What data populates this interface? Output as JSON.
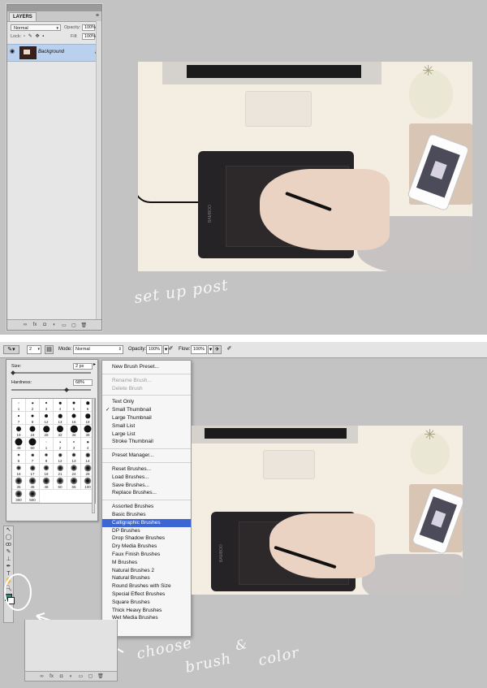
{
  "top": {
    "layers_panel": {
      "tab": "LAYERS",
      "blend_mode": "Normal",
      "opacity_label": "Opacity:",
      "opacity_value": "100%",
      "lock_label": "Lock:",
      "fill_label": "Fill:",
      "fill_value": "100%",
      "layer_name": "Background"
    },
    "caption": "set up post"
  },
  "bottom": {
    "options_bar": {
      "brush_size": "2",
      "mode_label": "Mode:",
      "mode_value": "Normal",
      "opacity_label": "Opacity:",
      "opacity_value": "100%",
      "flow_label": "Flow:",
      "flow_value": "100%"
    },
    "brush_picker": {
      "size_label": "Size:",
      "size_value": "2 px",
      "hardness_label": "Hardness:",
      "hardness_value": "68%",
      "presets": [
        {
          "n": "1",
          "d": 1,
          "soft": false
        },
        {
          "n": "2",
          "d": 1.5,
          "soft": false
        },
        {
          "n": "3",
          "d": 2,
          "soft": false
        },
        {
          "n": "4",
          "d": 2.5,
          "soft": false
        },
        {
          "n": "5",
          "d": 3,
          "soft": false
        },
        {
          "n": "6",
          "d": 3.5,
          "soft": false
        },
        {
          "n": "7",
          "d": 2,
          "soft": false
        },
        {
          "n": "9",
          "d": 3,
          "soft": false
        },
        {
          "n": "12",
          "d": 4,
          "soft": false
        },
        {
          "n": "13",
          "d": 4.5,
          "soft": false
        },
        {
          "n": "16",
          "d": 5,
          "soft": false
        },
        {
          "n": "18",
          "d": 5.5,
          "soft": false
        },
        {
          "n": "19",
          "d": 6,
          "soft": false
        },
        {
          "n": "24",
          "d": 7,
          "soft": false
        },
        {
          "n": "28",
          "d": 7.5,
          "soft": false
        },
        {
          "n": "32",
          "d": 8,
          "soft": false
        },
        {
          "n": "36",
          "d": 8.5,
          "soft": false
        },
        {
          "n": "38",
          "d": 9,
          "soft": false
        },
        {
          "n": "48",
          "d": 9.5,
          "soft": false
        },
        {
          "n": "60",
          "d": 10,
          "soft": false
        },
        {
          "n": "1",
          "d": 1,
          "soft": true
        },
        {
          "n": "2",
          "d": 1.5,
          "soft": true
        },
        {
          "n": "3",
          "d": 2,
          "soft": true
        },
        {
          "n": "4",
          "d": 2.5,
          "soft": true
        },
        {
          "n": "5",
          "d": 3,
          "soft": true
        },
        {
          "n": "7",
          "d": 3.5,
          "soft": true
        },
        {
          "n": "9",
          "d": 4,
          "soft": true
        },
        {
          "n": "12",
          "d": 4.5,
          "soft": true
        },
        {
          "n": "13",
          "d": 5,
          "soft": true
        },
        {
          "n": "14",
          "d": 5.5,
          "soft": true
        },
        {
          "n": "16",
          "d": 6,
          "soft": true
        },
        {
          "n": "17",
          "d": 6.5,
          "soft": true
        },
        {
          "n": "18",
          "d": 7,
          "soft": true
        },
        {
          "n": "21",
          "d": 7.5,
          "soft": true
        },
        {
          "n": "24",
          "d": 8,
          "soft": true
        },
        {
          "n": "28",
          "d": 8.5,
          "soft": true
        },
        {
          "n": "35",
          "d": 9,
          "soft": true
        },
        {
          "n": "45",
          "d": 9.5,
          "soft": true
        },
        {
          "n": "48",
          "d": 10,
          "soft": true
        },
        {
          "n": "60",
          "d": 10.5,
          "soft": true
        },
        {
          "n": "65",
          "d": 11,
          "soft": true
        },
        {
          "n": "100",
          "d": 11.5,
          "soft": true
        },
        {
          "n": "300",
          "d": 12,
          "soft": true
        },
        {
          "n": "500",
          "d": 12.5,
          "soft": true
        }
      ]
    },
    "menu": {
      "groups": [
        [
          {
            "label": "New Brush Preset..."
          }
        ],
        [
          {
            "label": "Rename Brush...",
            "disabled": true
          },
          {
            "label": "Delete Brush",
            "disabled": true
          }
        ],
        [
          {
            "label": "Text Only"
          },
          {
            "label": "Small Thumbnail",
            "checked": true
          },
          {
            "label": "Large Thumbnail"
          },
          {
            "label": "Small List"
          },
          {
            "label": "Large List"
          },
          {
            "label": "Stroke Thumbnail"
          }
        ],
        [
          {
            "label": "Preset Manager..."
          }
        ],
        [
          {
            "label": "Reset Brushes..."
          },
          {
            "label": "Load Brushes..."
          },
          {
            "label": "Save Brushes..."
          },
          {
            "label": "Replace Brushes..."
          }
        ],
        [
          {
            "label": "Assorted Brushes"
          },
          {
            "label": "Basic Brushes"
          },
          {
            "label": "Calligraphic Brushes",
            "highlighted": true
          },
          {
            "label": "DP Brushes"
          },
          {
            "label": "Drop Shadow Brushes"
          },
          {
            "label": "Dry Media Brushes"
          },
          {
            "label": "Faux Finish Brushes"
          },
          {
            "label": "M Brushes"
          },
          {
            "label": "Natural Brushes 2"
          },
          {
            "label": "Natural Brushes"
          },
          {
            "label": "Round Brushes with Size"
          },
          {
            "label": "Special Effect Brushes"
          },
          {
            "label": "Square Brushes"
          },
          {
            "label": "Thick Heavy Brushes"
          },
          {
            "label": "Wet Media Brushes"
          }
        ]
      ]
    },
    "caption_line1": "choose",
    "caption_line2": "brush",
    "caption_amp": "&",
    "caption_line3": "color",
    "foreground_color": "#3d7f73",
    "background_color": "#ffffff"
  }
}
